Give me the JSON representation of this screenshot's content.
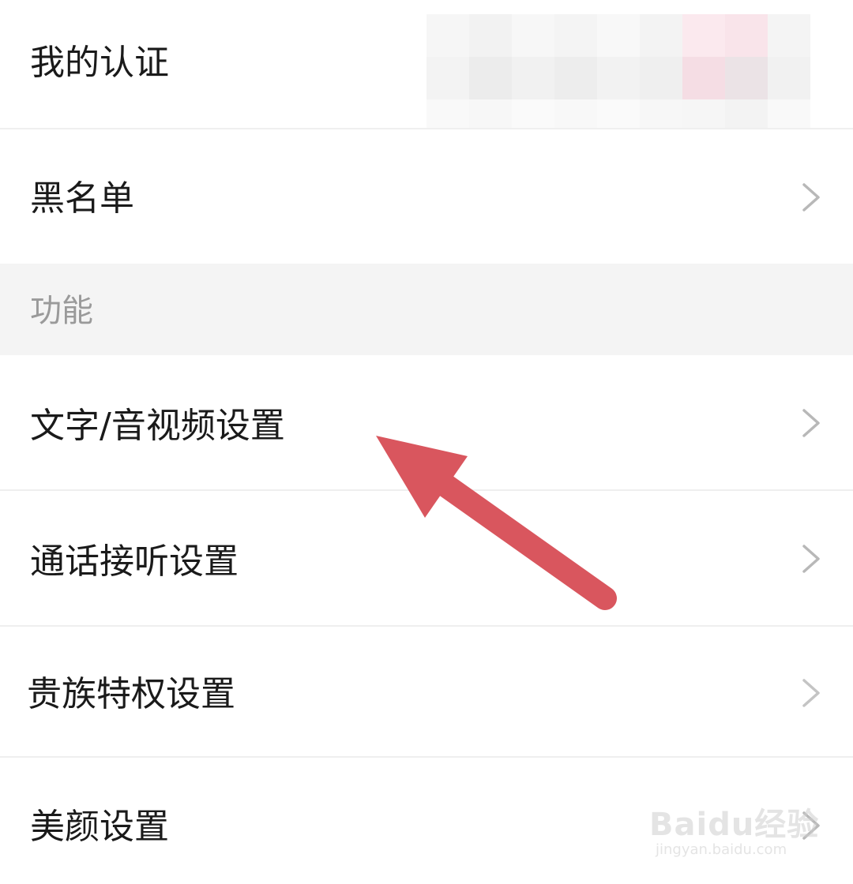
{
  "settings": {
    "items_top": [
      {
        "label": "我的认证"
      },
      {
        "label": "黑名单"
      }
    ],
    "section": {
      "title": "功能"
    },
    "items_features": [
      {
        "label": "文字/音视频设置"
      },
      {
        "label": "通话接听设置"
      },
      {
        "label": "贵族特权设置"
      },
      {
        "label": "美颜设置"
      }
    ]
  },
  "icons": {
    "chevron": "chevron-right-icon",
    "annotation_arrow": "arrow-up-left-icon"
  },
  "colors": {
    "annotation_arrow": "#d9565e",
    "section_bg": "#f4f4f4",
    "section_text": "#9a9a9a",
    "chevron": "#b8b8b8"
  },
  "watermark": {
    "brand": "Baidu经验",
    "url": "jingyan.baidu.com"
  }
}
